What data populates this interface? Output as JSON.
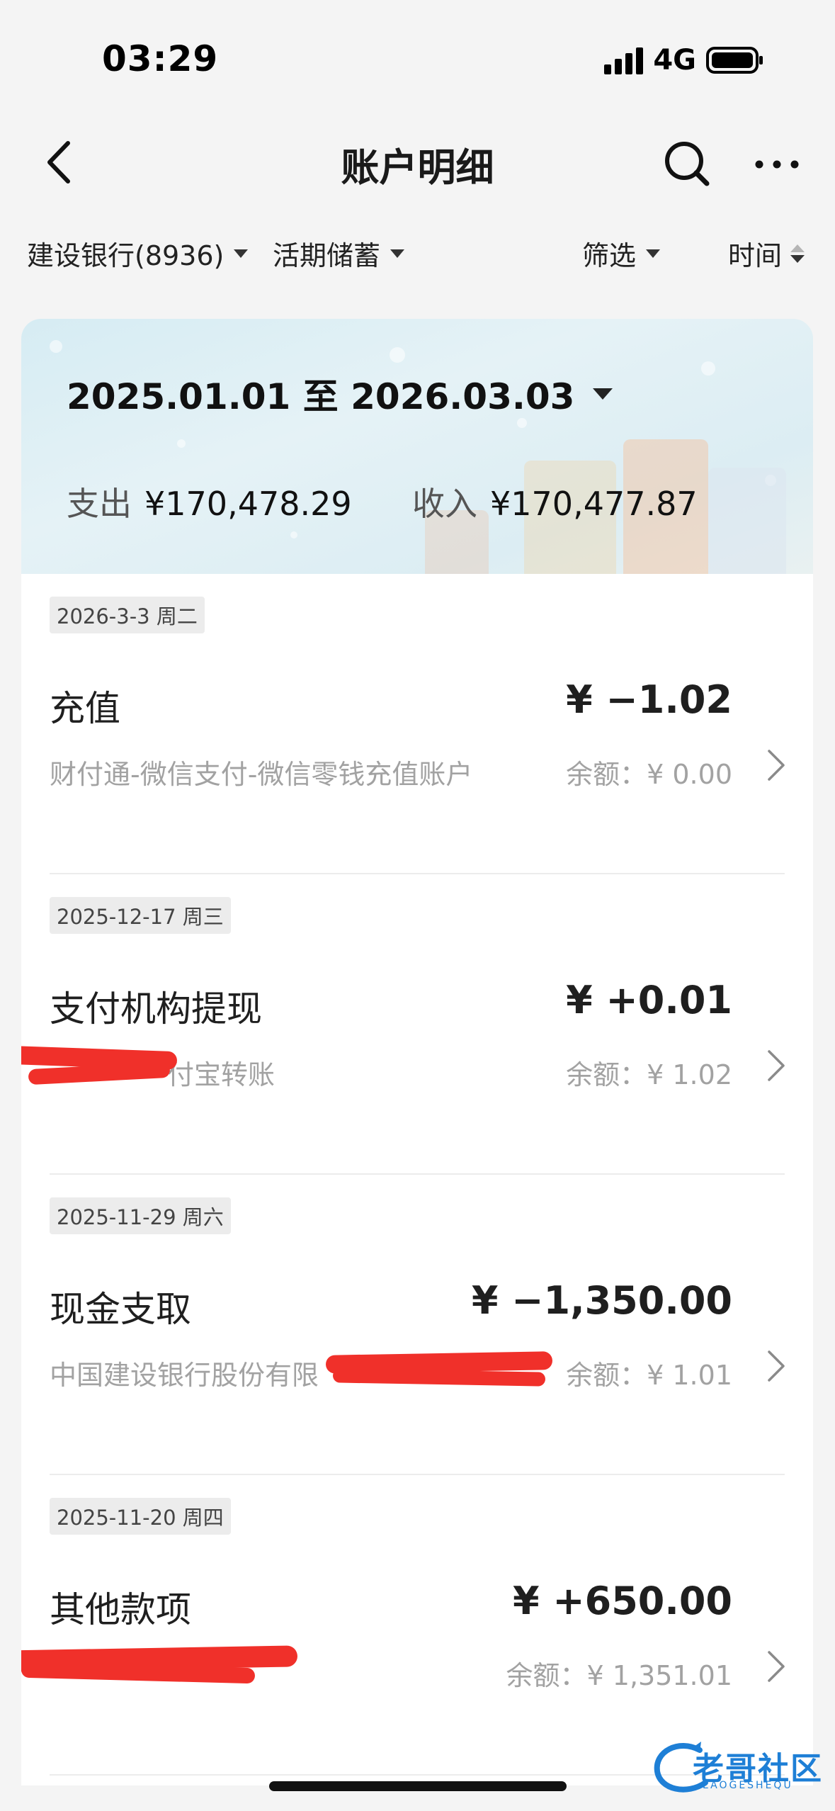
{
  "status_bar": {
    "time": "03:29",
    "network": "4G"
  },
  "nav": {
    "title": "账户明细",
    "icons": [
      "back-icon",
      "search-icon",
      "more-icon"
    ]
  },
  "filters": {
    "account": "建设银行(8936)",
    "account_type": "活期储蓄",
    "filter": "筛选",
    "sort": "时间"
  },
  "summary": {
    "date_range": "2025.01.01 至 2026.03.03",
    "expense_label": "支出",
    "expense_value": "¥170,478.29",
    "income_label": "收入",
    "income_value": "¥170,477.87"
  },
  "transactions": [
    {
      "date": "2026-3-3 周二",
      "title": "充值",
      "amount": "¥ −1.02",
      "description": "财付通-微信支付-微信零钱充值账户",
      "balance": "余额：¥ 0.00"
    },
    {
      "date": "2025-12-17 周三",
      "title": "支付机构提现",
      "amount": "¥ +0.01",
      "description": "付宝转账",
      "balance": "余额：¥ 1.02"
    },
    {
      "date": "2025-11-29 周六",
      "title": "现金支取",
      "amount": "¥ −1,350.00",
      "description": "中国建设银行股份有限",
      "balance": "余额：¥ 1.01"
    },
    {
      "date": "2025-11-20 周四",
      "title": "其他款项",
      "amount": "¥ +650.00",
      "description": "",
      "balance": "余额：¥ 1,351.01"
    }
  ],
  "watermark": {
    "text": "老哥社区",
    "sub": "LAOGESHEQU"
  },
  "colors": {
    "redaction": "#f0302a",
    "watermark": "#1e7fd6"
  }
}
